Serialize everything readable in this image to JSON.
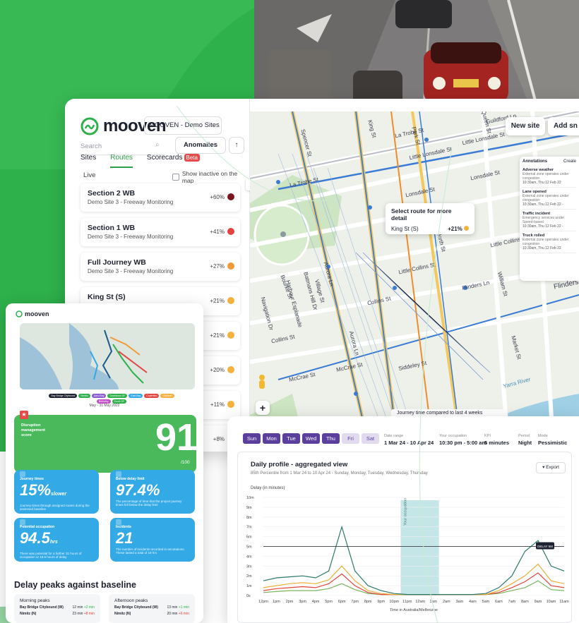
{
  "brand": {
    "name": "mooven",
    "green": "#2eb04b",
    "purple": "#5a3f9d",
    "blue": "#33a9e6"
  },
  "sidebar": {
    "site_select": "MOOVEN - Demo Sites - A...",
    "search_placeholder": "Search",
    "anomalies_label": "Anomalies",
    "sort_icon": "arrow-up-icon",
    "tabs": [
      {
        "label": "Sites"
      },
      {
        "label": "Routes"
      },
      {
        "label": "Scorecards"
      }
    ],
    "beta_label": "Beta",
    "live_label": "Live",
    "show_inactive_label": "Show inactive on the map",
    "routes": [
      {
        "name": "Section 2 WB",
        "sub": "Demo Site 3 - Freeway Monitoring",
        "pct": "+60%",
        "color": "#7a1520"
      },
      {
        "name": "Section 1 WB",
        "sub": "Demo Site 3 - Freeway Monitoring",
        "pct": "+41%",
        "color": "#e2453f"
      },
      {
        "name": "Full Journey WB",
        "sub": "Demo Site 3 - Freeway Monitoring",
        "pct": "+27%",
        "color": "#f29a3a"
      },
      {
        "name": "King St (S)",
        "sub": "Melbourne Demo",
        "pct": "+21%",
        "color": "#f5b13d"
      },
      {
        "name": "",
        "sub": "",
        "pct": "+21%",
        "color": "#f5b13d"
      },
      {
        "name": "",
        "sub": "",
        "pct": "+20%",
        "color": "#f5b13d"
      },
      {
        "name": "",
        "sub": "",
        "pct": "+11%",
        "color": "#f5b13d"
      },
      {
        "name": "",
        "sub": "",
        "pct": "+8%",
        "color": "#f5b13d"
      }
    ]
  },
  "map": {
    "new_site_label": "New site",
    "add_label": "Add sn",
    "zoom_in": "+",
    "footer_note": "Journey time compared to last 4 weeks",
    "popup": {
      "title": "Select route for more detail",
      "route": "King St (S)",
      "pct": "+21%"
    },
    "labels": {
      "la_trobe_1": "La Trobe St",
      "la_trobe_2": "La Trobe St",
      "guildford": "Guildford Ln",
      "little_lonsdale_1": "Little Lonsdale St",
      "little_lonsdale_2": "Little Lonsdale St",
      "lonsdale_1": "Lonsdale St",
      "lonsdale_2": "Lonsdale St",
      "little_collins_1": "Little Collins St",
      "little_collins_2": "Little Collins St",
      "collins_1": "Collins St",
      "collins_2": "Collins St",
      "flinders_ln": "Flinders Ln",
      "flinders": "Flinders",
      "bourke": "Bourke St",
      "mccrae": "McCrae St",
      "mccrae_2": "McCrae St",
      "siddeley": "Siddeley St",
      "navigation": "Navigation Dr",
      "harbour": "Harbour Esplanade",
      "batmans": "Batmans Hill Dr",
      "village": "Village St",
      "aurora": "Aurora Ln",
      "aurora_2": "Aurora Ln",
      "spencer": "Spencer St",
      "king": "King St",
      "park": "Park St",
      "queen": "Queen St",
      "william": "William St",
      "market": "Market St",
      "north": "North St",
      "yarra": "Yarra River"
    }
  },
  "annotations": {
    "header": "Annotations",
    "create": "Create",
    "items": [
      {
        "title": "Adverse weather",
        "body": "External zone operates under congestion",
        "time": "10:30am, Thu 12 Feb 22"
      },
      {
        "title": "Lane opened",
        "body": "External zone operates under congestion",
        "time": "10:30am, Thu 12 Feb 22 -"
      },
      {
        "title": "Traffic incident",
        "body": "Emergency services under Speed-based",
        "time": "10:30am, Thu 12 Feb 22 -"
      },
      {
        "title": "Truck rolled",
        "body": "External zone operates under congestion",
        "time": "10:30am, Thu 12 Feb 22"
      }
    ]
  },
  "stats": {
    "logo": "mooven",
    "legend": [
      "Bay Bridge Citybound",
      "Ninnitz",
      "Aero Bay",
      "Downtown SF",
      "East Bay",
      "Cupertino",
      "Oakland",
      "Berkeley",
      "South SF"
    ],
    "date_range": "May - 31 May 2022",
    "score": {
      "label": "Disruption management score",
      "value": "91",
      "denom": "/100"
    },
    "tiles": [
      {
        "label": "Journey times",
        "value": "15%",
        "unit": "slower",
        "sub": "Journey times through assigned routes during the assessed baseline"
      },
      {
        "label": "Below delay limit",
        "value": "97.4%",
        "unit": "",
        "sub": "The percentage of time that the project journey times fell below the delay limit"
      },
      {
        "label": "Potential occupation",
        "value": "94.5",
        "unit": "hrs",
        "sub": "There was potential for a further 31 hours of occupation or 18.6 hours of delay"
      },
      {
        "label": "Incidents",
        "value": "21",
        "unit": "",
        "sub": "The number of incidents recorded in annotations. These lasted a total of 18 hrs"
      }
    ],
    "delay_title": "Delay peaks against baseline",
    "morning": {
      "title": "Morning peaks",
      "rows": [
        {
          "name": "Bay Bridge Citybound (W)",
          "val": "12 min",
          "delta": "+2 min"
        },
        {
          "name": "Nimitz (N)",
          "val": "23 min",
          "delta": "+8 min"
        }
      ]
    },
    "afternoon": {
      "title": "Afternoon peaks",
      "rows": [
        {
          "name": "Bay Bridge Citybound (W)",
          "val": "13 min",
          "delta": "+1 min"
        },
        {
          "name": "Nimitz (N)",
          "val": "20 min",
          "delta": "+6 min"
        }
      ]
    }
  },
  "chart_panel": {
    "days": [
      {
        "label": "Sun",
        "on": true
      },
      {
        "label": "Mon",
        "on": true
      },
      {
        "label": "Tue",
        "on": true
      },
      {
        "label": "Wed",
        "on": true
      },
      {
        "label": "Thu",
        "on": true
      },
      {
        "label": "Fri",
        "on": false
      },
      {
        "label": "Sat",
        "on": false
      }
    ],
    "meta": [
      {
        "label": "Date range",
        "value": "1 Mar 24 - 10 Apr 24"
      },
      {
        "label": "Your occupation",
        "value": "10:30 pm - 5:00 am"
      },
      {
        "label": "KPI",
        "value": "5 minutes"
      },
      {
        "label": "Period",
        "value": "Night"
      },
      {
        "label": "Mode",
        "value": "Pessimistic"
      }
    ],
    "title": "Daily profile - aggregated view",
    "subtitle": "85th Percentile from 1 Mar 24 to 10 Apr 24 - Sunday, Monday, Tuesday, Wednesday, Thursday",
    "export_label": "Export",
    "ylabel": "Delay (in minutes)",
    "xlabel": "Time in Australia/Melbourne",
    "occupation_label": "Your occupation",
    "delay_label": "DELAY 5M"
  },
  "chart_data": {
    "type": "line",
    "title": "Daily profile - aggregated view",
    "ylabel": "Delay (in minutes)",
    "xlabel": "Time in Australia/Melbourne",
    "ylim": [
      0,
      10
    ],
    "yticks": [
      "10m",
      "9m",
      "8m",
      "7m",
      "6m",
      "5m",
      "4m",
      "3m",
      "2m",
      "1m",
      "0s"
    ],
    "categories": [
      "12pm",
      "1pm",
      "2pm",
      "3pm",
      "4pm",
      "5pm",
      "6pm",
      "7pm",
      "8pm",
      "9pm",
      "10pm",
      "11pm",
      "12am",
      "1am",
      "2am",
      "3am",
      "4am",
      "5am",
      "6am",
      "7am",
      "8am",
      "9am",
      "10am",
      "11am"
    ],
    "threshold": 5,
    "occupation_range": [
      10.5,
      17
    ],
    "series": [
      {
        "color": "#2b7a6b",
        "values": [
          1.5,
          1.8,
          1.9,
          2.0,
          1.8,
          2.5,
          7.0,
          2.5,
          1.0,
          0.5,
          0.2,
          0.1,
          0.1,
          0.1,
          0.1,
          0.1,
          0.1,
          0.2,
          0.8,
          2.0,
          4.5,
          5.6,
          3.0,
          2.5
        ]
      },
      {
        "color": "#e8b03a",
        "values": [
          0.8,
          1.0,
          1.2,
          1.3,
          1.2,
          1.6,
          3.0,
          1.5,
          0.5,
          0.2,
          0.1,
          0.1,
          0.1,
          0.1,
          0.1,
          0.1,
          0.1,
          0.1,
          0.5,
          1.2,
          2.0,
          3.2,
          1.5,
          1.2
        ]
      },
      {
        "color": "#e2453f",
        "values": [
          0.5,
          0.7,
          0.8,
          0.9,
          0.8,
          1.2,
          2.2,
          1.0,
          0.3,
          0.1,
          0.1,
          0.1,
          0.1,
          0.1,
          0.1,
          0.1,
          0.1,
          0.1,
          0.3,
          0.8,
          1.4,
          2.3,
          1.0,
          0.8
        ]
      },
      {
        "color": "#7ab55c",
        "values": [
          0.3,
          0.4,
          0.5,
          0.5,
          0.5,
          0.7,
          1.2,
          0.6,
          0.2,
          0.1,
          0.1,
          0.1,
          0.1,
          0.1,
          0.1,
          0.1,
          0.1,
          0.1,
          0.2,
          0.5,
          0.8,
          1.5,
          0.6,
          0.5
        ]
      }
    ]
  }
}
